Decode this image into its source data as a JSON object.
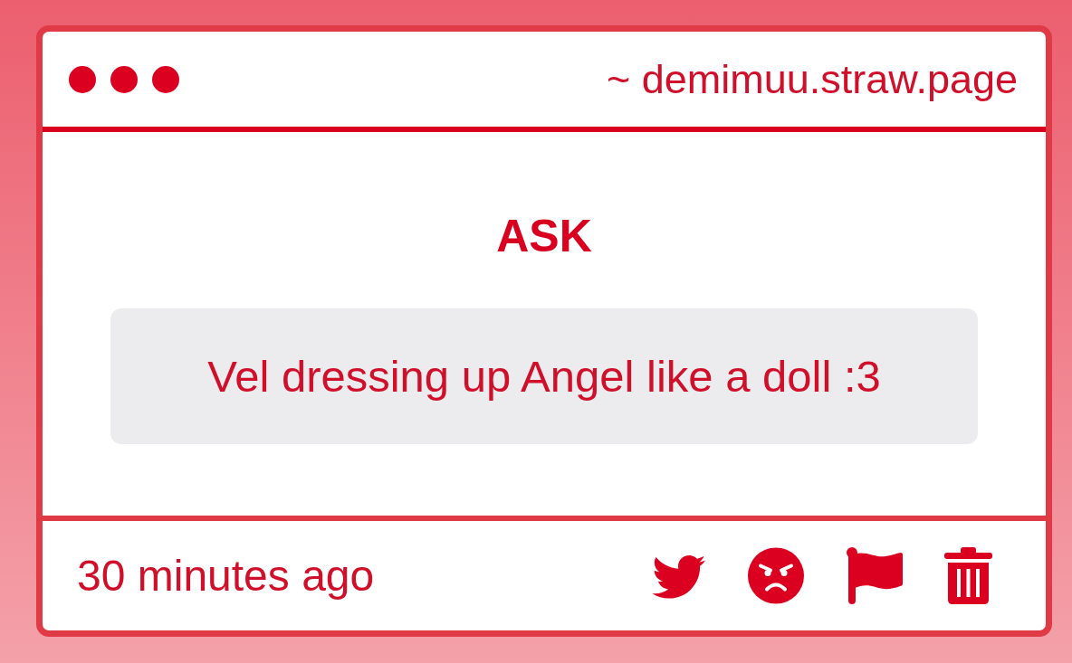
{
  "address_bar": {
    "url": "~ demimuu.straw.page"
  },
  "card": {
    "heading": "ASK",
    "question": "Vel dressing up Angel like a doll :3"
  },
  "footer": {
    "time": "30 minutes ago",
    "actions": [
      {
        "kind": "bird"
      },
      {
        "kind": "angry"
      },
      {
        "kind": "flag"
      },
      {
        "kind": "trash"
      }
    ]
  }
}
